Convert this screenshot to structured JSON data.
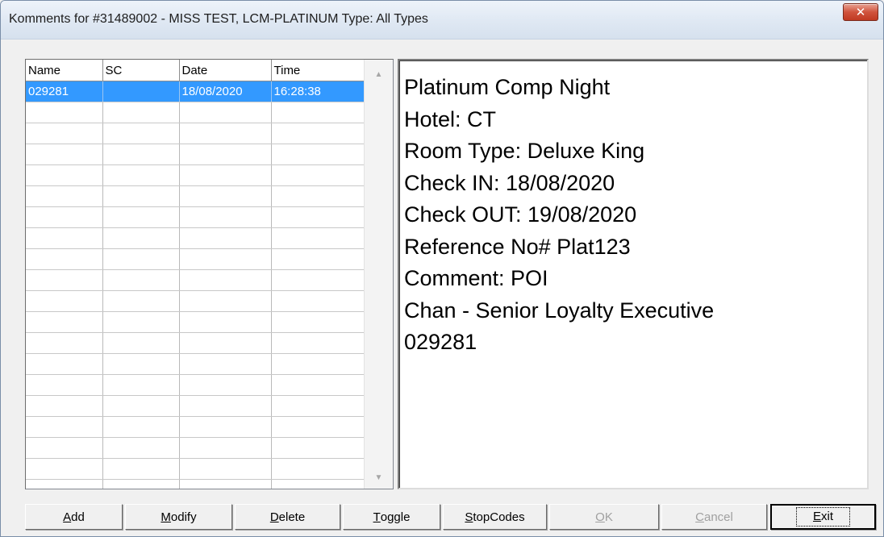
{
  "window": {
    "title": "Komments for #31489002 - MISS TEST, LCM-PLATINUM   Type: All Types",
    "close_glyph": "✕"
  },
  "grid": {
    "columns": [
      "Name",
      "SC",
      "Date",
      "Time"
    ],
    "rows": [
      {
        "name": "029281",
        "sc": "",
        "date": "18/08/2020",
        "time": "16:28:38",
        "selected": true
      }
    ]
  },
  "comment": {
    "lines": [
      "Platinum Comp Night",
      "Hotel: CT",
      "Room Type: Deluxe King",
      "Check IN: 18/08/2020",
      "Check OUT: 19/08/2020",
      "Reference No# Plat123",
      "Comment: POI",
      "Chan - Senior Loyalty Executive",
      "029281"
    ]
  },
  "buttons": {
    "add": {
      "first": "A",
      "rest": "dd"
    },
    "modify": {
      "first": "M",
      "rest": "odify"
    },
    "delete": {
      "first": "D",
      "rest": "elete"
    },
    "toggle": {
      "first": "T",
      "rest": "oggle"
    },
    "stopcodes": {
      "first": "S",
      "rest": "topCodes"
    },
    "ok": {
      "first": "O",
      "rest": "K"
    },
    "cancel": {
      "first": "C",
      "rest": "ancel"
    },
    "exit": {
      "first": "E",
      "rest": "xit"
    }
  },
  "icons": {
    "scroll_up": "scroll-up-arrow-icon",
    "scroll_down": "scroll-down-arrow-icon",
    "close": "close-icon"
  },
  "colors": {
    "selection": "#3399ff",
    "close_button": "#c8462f"
  }
}
